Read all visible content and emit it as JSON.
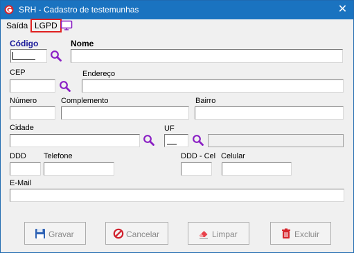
{
  "window": {
    "title": "SRH - Cadastro de testemunhas",
    "close_glyph": "✕"
  },
  "menu": {
    "saida": "Saída",
    "lgpd": "LGPD",
    "monitor_icon": "monitor-icon"
  },
  "labels": {
    "codigo": "Código",
    "nome": "Nome",
    "cep": "CEP",
    "endereco": "Endereço",
    "numero": "Número",
    "complemento": "Complemento",
    "bairro": "Bairro",
    "cidade": "Cidade",
    "uf": "UF",
    "ddd": "DDD",
    "telefone": "Telefone",
    "ddd_cel": "DDD - Cel",
    "celular": "Celular",
    "email": "E-Mail"
  },
  "values": {
    "codigo": "",
    "nome": "",
    "cep": "",
    "endereco": "",
    "numero": "",
    "complemento": "",
    "bairro": "",
    "cidade": "",
    "uf": "",
    "uf_desc": "",
    "ddd": "",
    "telefone": "",
    "ddd_cel": "",
    "celular": "",
    "email": ""
  },
  "buttons": {
    "gravar": "Gravar",
    "cancelar": "Cancelar",
    "limpar": "Limpar",
    "excluir": "Excluir"
  },
  "colors": {
    "titlebar": "#1a73c0",
    "accent_search": "#8a1fc4",
    "lgpd_highlight": "#e02020",
    "label_blue": "#1a1a9a"
  }
}
